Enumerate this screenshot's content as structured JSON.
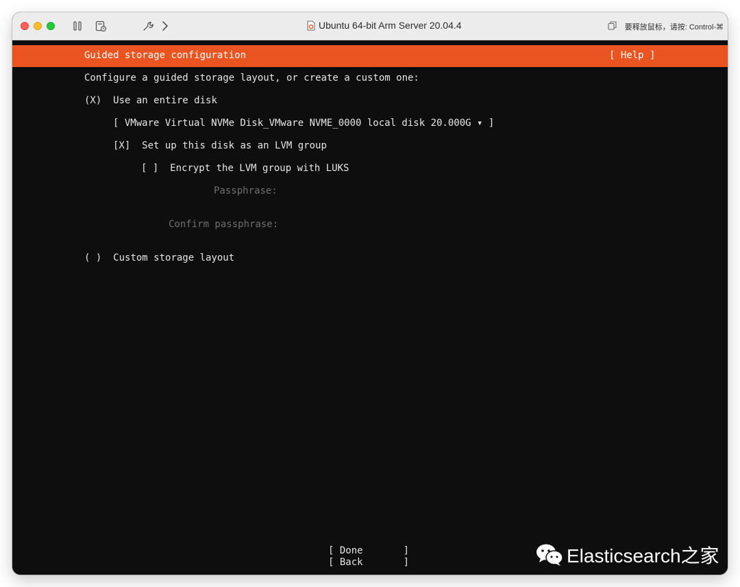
{
  "window": {
    "title": "Ubuntu 64-bit Arm Server 20.04.4",
    "release_hint": "要释放鼠标，请按: Control-⌘"
  },
  "icons": {
    "pause": "pause-icon",
    "snapshot": "snapshot-icon",
    "settings": "wrench-icon",
    "forward": "chevron-right-icon",
    "document": "document-icon",
    "copy": "copy-icon"
  },
  "colors": {
    "header_bg": "#e95420",
    "terminal_bg": "#0e0e0e",
    "text": "#e6e6e6",
    "dim_text": "#6f6f6f"
  },
  "installer": {
    "header_title": "Guided storage configuration",
    "help_label": "[ Help ]",
    "intro": "Configure a guided storage layout, or create a custom one:",
    "entire_disk": {
      "marker": "(X)",
      "label": "Use an entire disk",
      "selected": true
    },
    "disk_select": {
      "value": "[ VMware Virtual NVMe Disk_VMware NVME_0000 local disk 20.000G ▾ ]"
    },
    "lvm": {
      "marker": "[X]",
      "label": "Set up this disk as an LVM group",
      "checked": true
    },
    "encrypt": {
      "marker": "[ ]",
      "label": "Encrypt the LVM group with LUKS",
      "checked": false
    },
    "passphrase_label": "Passphrase:",
    "confirm_passphrase_label": "Confirm passphrase:",
    "custom_layout": {
      "marker": "( )",
      "label": "Custom storage layout",
      "selected": false
    },
    "done_button": "[ Done       ]",
    "back_button": "[ Back       ]"
  },
  "watermark": {
    "text": "Elasticsearch之家"
  }
}
